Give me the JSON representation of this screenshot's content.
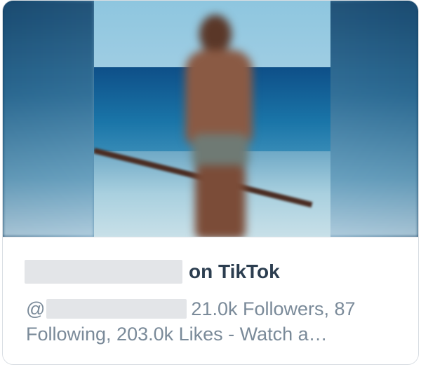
{
  "card": {
    "title_suffix": "on TikTok",
    "handle_prefix": "@",
    "stats_text": "21.0k Followers, 87 Following, 203.0k Likes - Watch a…"
  },
  "colors": {
    "title": "#2c3e50",
    "description": "#7a8a99",
    "border": "#d9dee3"
  }
}
